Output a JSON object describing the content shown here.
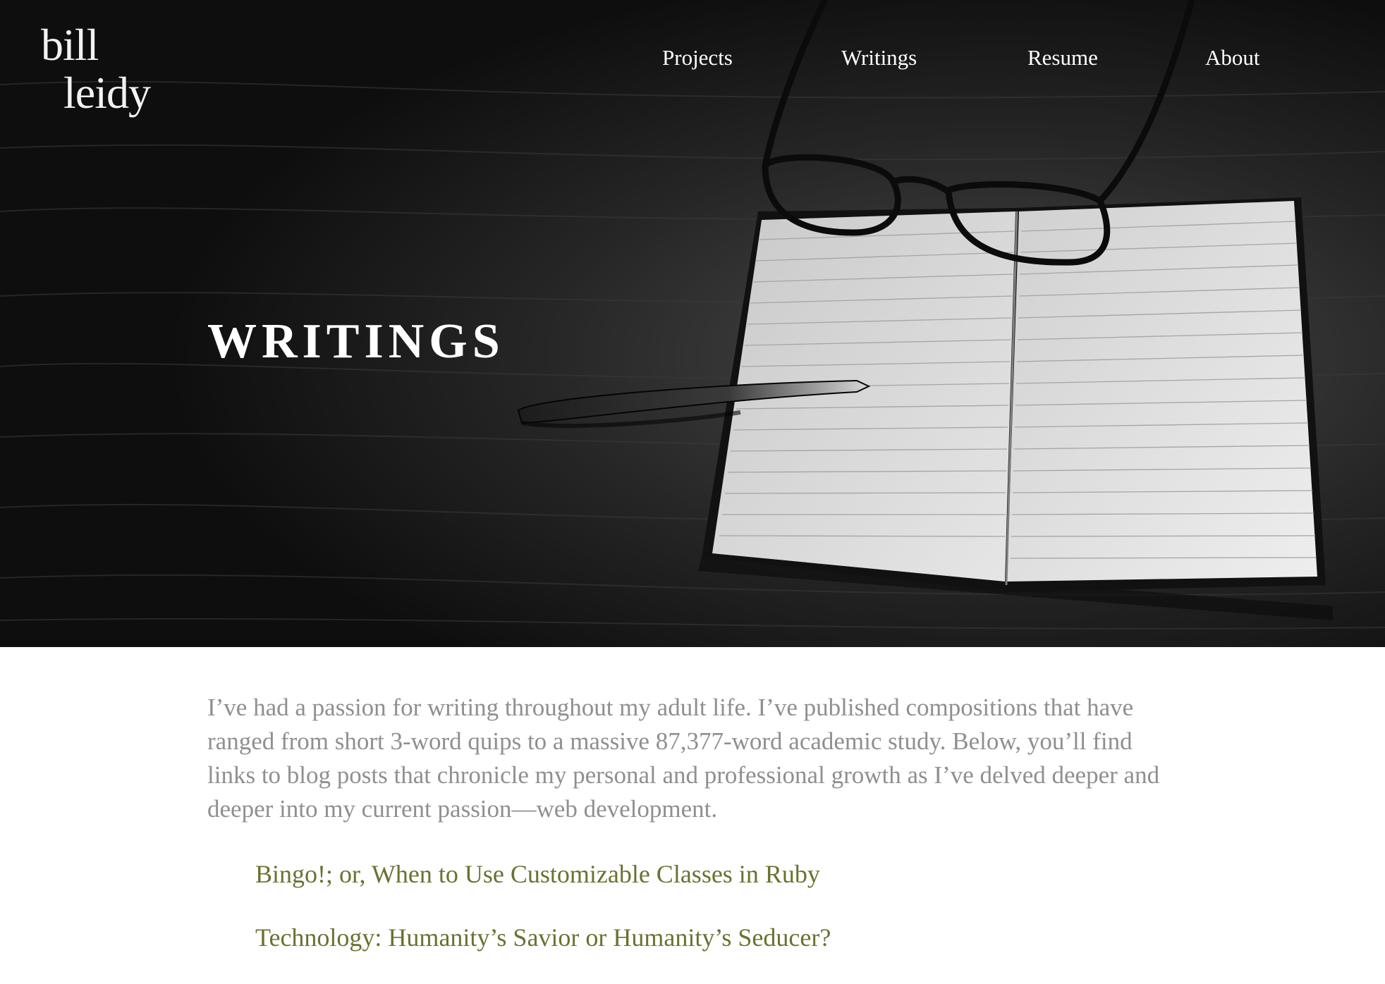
{
  "logo": {
    "line1": "bill",
    "line2": "leidy"
  },
  "nav": {
    "items": [
      {
        "label": "Projects"
      },
      {
        "label": "Writings"
      },
      {
        "label": "Resume"
      },
      {
        "label": "About"
      }
    ]
  },
  "hero": {
    "title": "WRITINGS"
  },
  "intro": {
    "text": "I’ve had a passion for writing throughout my adult life. I’ve published compositions that have ranged from short 3-word quips to a massive 87,377-word academic study. Below, you’ll find links to blog posts that chronicle my personal and professional growth as I’ve delved deeper and deeper into my current passion—web development."
  },
  "posts": [
    {
      "title": "Bingo!; or, When to Use Customizable Classes in Ruby"
    },
    {
      "title": "Technology: Humanity’s Savior or Humanity’s Seducer?"
    }
  ],
  "colors": {
    "link": "#6b7130",
    "intro_text": "#8f8f8f",
    "hero_text": "#ffffff"
  }
}
